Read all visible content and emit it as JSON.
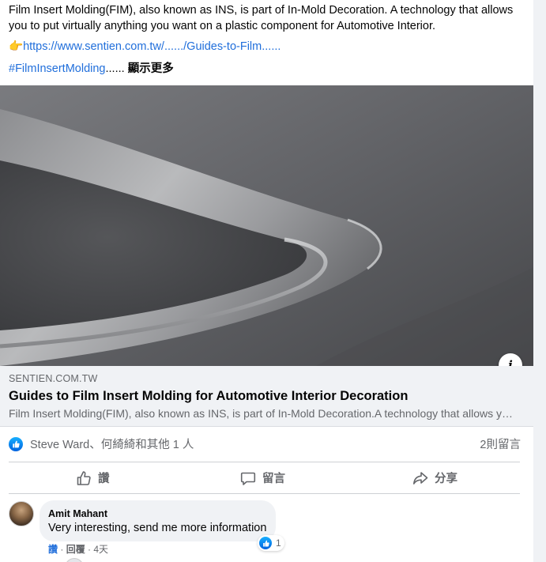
{
  "post": {
    "text": "Film Insert Molding(FIM), also known as INS, is part of In-Mold Decoration. A technology that allows you to put virtually anything you want on a plastic component for Automotive Interior.",
    "link_emoji": "👉",
    "link_text": "https://www.sentien.com.tw/....../Guides-to-Film......",
    "hashtag": "#FilmInsertMolding",
    "ellipsis": "......",
    "see_more": "顯示更多"
  },
  "link_preview": {
    "domain": "SENTIEN.COM.TW",
    "title": "Guides to Film Insert Molding for Automotive Interior Decoration",
    "description": "Film Insert Molding(FIM), also known as INS, is part of In-Mold Decoration.A technology that allows you to put virtually anything you want on a plastic component"
  },
  "reactions": {
    "summary": "Steve Ward、何綺綺和其他 1 人",
    "comment_count": "2則留言"
  },
  "actions": {
    "like": "讚",
    "comment": "留言",
    "share": "分享"
  },
  "comment": {
    "author": "Amit Mahant",
    "text": "Very interesting, send me more information",
    "reaction_count": "1",
    "like_label": "讚",
    "separator1": " · ",
    "reply_label": "回覆",
    "separator2": " · ",
    "time": "4天"
  },
  "colors": {
    "link": "#216fdb",
    "secondary_text": "#65676b",
    "like_blue": "#0062df"
  }
}
